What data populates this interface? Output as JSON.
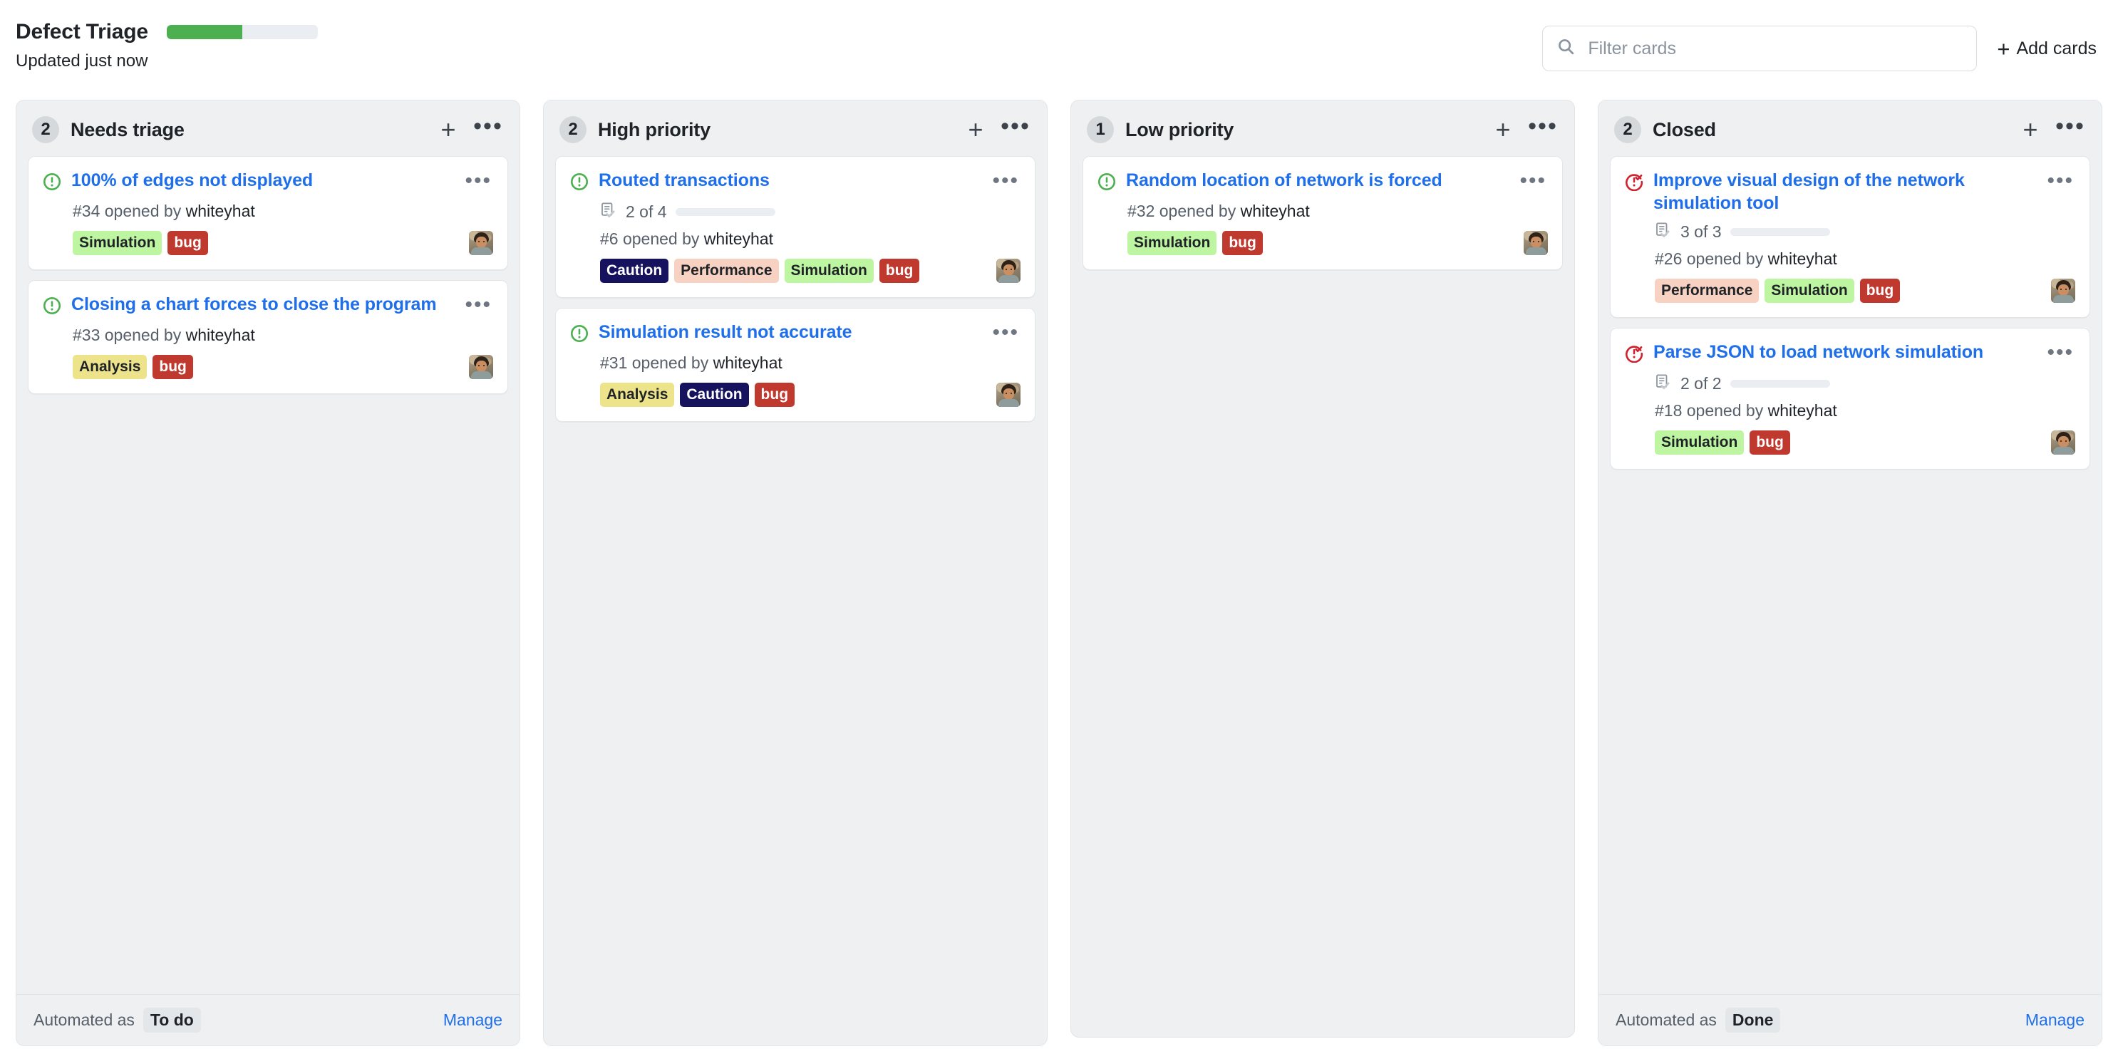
{
  "header": {
    "title": "Defect Triage",
    "updated_text": "Updated just now",
    "progress_percent": 50,
    "progress_color": "#4caf50",
    "search": {
      "placeholder": "Filter cards",
      "value": "",
      "icon": "search-icon"
    },
    "add_cards_label": "Add cards",
    "add_cards_icon": "plus-icon"
  },
  "label_styles": {
    "Simulation": {
      "bg": "#bdf5a0",
      "fg": "#1f2328"
    },
    "bug": {
      "bg": "#c0392f",
      "fg": "#ffffff"
    },
    "Analysis": {
      "bg": "#ece38b",
      "fg": "#1f2328"
    },
    "Caution": {
      "bg": "#17125e",
      "fg": "#ffffff"
    },
    "Performance": {
      "bg": "#f7d2c2",
      "fg": "#1f2328"
    }
  },
  "columns": [
    {
      "id": "needs-triage",
      "title": "Needs triage",
      "count": "2",
      "add_icon": "plus-icon",
      "menu_icon": "ellipsis-icon",
      "footer": {
        "prefix": "Automated as",
        "chip": "To do",
        "manage": "Manage"
      },
      "cards": [
        {
          "state": "open",
          "title": "100% of edges not displayed",
          "meta": "#34 opened by whiteyhat",
          "number": "#34",
          "author": "whiteyhat",
          "tasks": null,
          "labels": [
            "Simulation",
            "bug"
          ],
          "assignee": "whiteyhat-avatar"
        },
        {
          "state": "open",
          "title": "Closing a chart forces to close the program",
          "meta": "#33 opened by whiteyhat",
          "number": "#33",
          "author": "whiteyhat",
          "tasks": null,
          "labels": [
            "Analysis",
            "bug"
          ],
          "assignee": "whiteyhat-avatar"
        }
      ]
    },
    {
      "id": "high-priority",
      "title": "High priority",
      "count": "2",
      "add_icon": "plus-icon",
      "menu_icon": "ellipsis-icon",
      "footer": null,
      "cards": [
        {
          "state": "open",
          "title": "Routed transactions",
          "meta": "#6 opened by whiteyhat",
          "number": "#6",
          "author": "whiteyhat",
          "tasks": {
            "text": "2 of 4",
            "done": 2,
            "total": 4,
            "percent": 50
          },
          "labels": [
            "Caution",
            "Performance",
            "Simulation",
            "bug"
          ],
          "assignee": "whiteyhat-avatar"
        },
        {
          "state": "open",
          "title": "Simulation result not accurate",
          "meta": "#31 opened by whiteyhat",
          "number": "#31",
          "author": "whiteyhat",
          "tasks": null,
          "labels": [
            "Analysis",
            "Caution",
            "bug"
          ],
          "assignee": "whiteyhat-avatar"
        }
      ]
    },
    {
      "id": "low-priority",
      "title": "Low priority",
      "count": "1",
      "add_icon": "plus-icon",
      "menu_icon": "ellipsis-icon",
      "footer": null,
      "cards": [
        {
          "state": "open",
          "title": "Random location of network is forced",
          "meta": "#32 opened by whiteyhat",
          "number": "#32",
          "author": "whiteyhat",
          "tasks": null,
          "labels": [
            "Simulation",
            "bug"
          ],
          "assignee": "whiteyhat-avatar"
        }
      ]
    },
    {
      "id": "closed",
      "title": "Closed",
      "count": "2",
      "add_icon": "plus-icon",
      "menu_icon": "ellipsis-icon",
      "footer": {
        "prefix": "Automated as",
        "chip": "Done",
        "manage": "Manage"
      },
      "cards": [
        {
          "state": "closed",
          "title": "Improve visual design of the network simulation tool",
          "meta": "#26 opened by whiteyhat",
          "number": "#26",
          "author": "whiteyhat",
          "tasks": {
            "text": "3 of 3",
            "done": 3,
            "total": 3,
            "percent": 100
          },
          "labels": [
            "Performance",
            "Simulation",
            "bug"
          ],
          "assignee": "whiteyhat-avatar"
        },
        {
          "state": "closed",
          "title": "Parse JSON to load network simulation",
          "meta": "#18 opened by whiteyhat",
          "number": "#18",
          "author": "whiteyhat",
          "tasks": {
            "text": "2 of 2",
            "done": 2,
            "total": 2,
            "percent": 100
          },
          "labels": [
            "Simulation",
            "bug"
          ],
          "assignee": "whiteyhat-avatar"
        }
      ]
    }
  ]
}
